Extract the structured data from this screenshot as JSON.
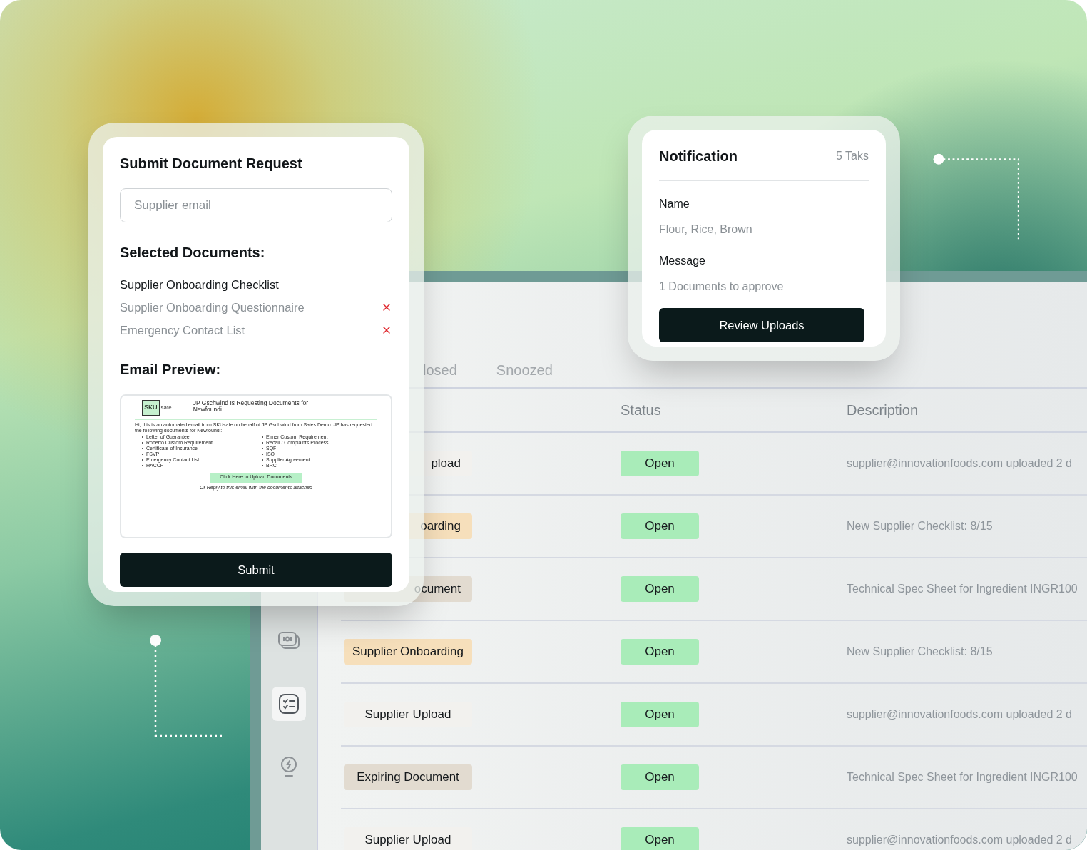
{
  "document_request": {
    "title": "Submit Document Request",
    "email_field": {
      "placeholder": "Supplier email"
    },
    "selected_heading": "Selected Documents:",
    "documents": [
      {
        "name": "Supplier Onboarding Checklist",
        "removable": false
      },
      {
        "name": "Supplier Onboarding Questionnaire",
        "removable": true
      },
      {
        "name": "Emergency Contact List",
        "removable": true
      }
    ],
    "preview_heading": "Email Preview:",
    "email_preview": {
      "logo_mark": "SKU",
      "logo_word": "safe",
      "heading": "JP Gschwind Is Requesting Documents for Newfoundi",
      "intro": "Hi, this is an automated email from SKUsafe on behalf of JP Gschwind from Sales Demo. JP has requested the following documents for Newfoundi:",
      "items": [
        "Letter of Guarantee",
        "Elmer Custom Requirement",
        "Roberto Custom Requirement",
        "Recall / Complaints Process",
        "Certificate of Insurance",
        "SQF",
        "FSVP",
        "ISO",
        "Emergency Contact List",
        "Supplier Agreement",
        "HACCP",
        "BRC"
      ],
      "button": "Click Here to Upload Documents",
      "footer": "Or Reply to this email with the documents attached"
    },
    "submit": "Submit"
  },
  "notification": {
    "title": "Notification",
    "count": "5 Taks",
    "fields": [
      {
        "label": "Name",
        "value": "Flour, Rice, Brown"
      },
      {
        "label": "Message",
        "value": "1 Documents to approve"
      }
    ],
    "button": "Review Uploads"
  },
  "tasks": {
    "sidebar": [
      {
        "kind": "documents",
        "selected": false
      },
      {
        "kind": "checklist",
        "selected": true
      },
      {
        "kind": "bulb",
        "selected": false
      }
    ],
    "tabs": [
      {
        "label": "losed",
        "selected": false
      },
      {
        "label": "Snoozed",
        "selected": false
      }
    ],
    "columns": [
      "Status",
      "Description"
    ],
    "rows": [
      {
        "type": "pload",
        "color": "#f2f1ee",
        "status": "Open",
        "description": "supplier@innovationfoods.com uploaded 2 d"
      },
      {
        "type": "oarding",
        "color": "#f6dfbb",
        "status": "Open",
        "description": "New Supplier Checklist: 8/15"
      },
      {
        "type": "ocument",
        "color": "#e2dbd0",
        "status": "Open",
        "description": "Technical Spec Sheet for Ingredient INGR100"
      },
      {
        "type": "Supplier Onboarding",
        "color": "#f6dfbb",
        "status": "Open",
        "description": "New Supplier Checklist: 8/15"
      },
      {
        "type": "Supplier Upload",
        "color": "#f2f1ee",
        "status": "Open",
        "description": "supplier@innovationfoods.com uploaded 2 d"
      },
      {
        "type": "Expiring Document",
        "color": "#e2dbd0",
        "status": "Open",
        "description": "Technical Spec Sheet for Ingredient INGR100"
      },
      {
        "type": "Supplier Upload",
        "color": "#f2f1ee",
        "status": "Open",
        "description": "supplier@innovationfoods.com uploaded 2 d"
      }
    ]
  }
}
